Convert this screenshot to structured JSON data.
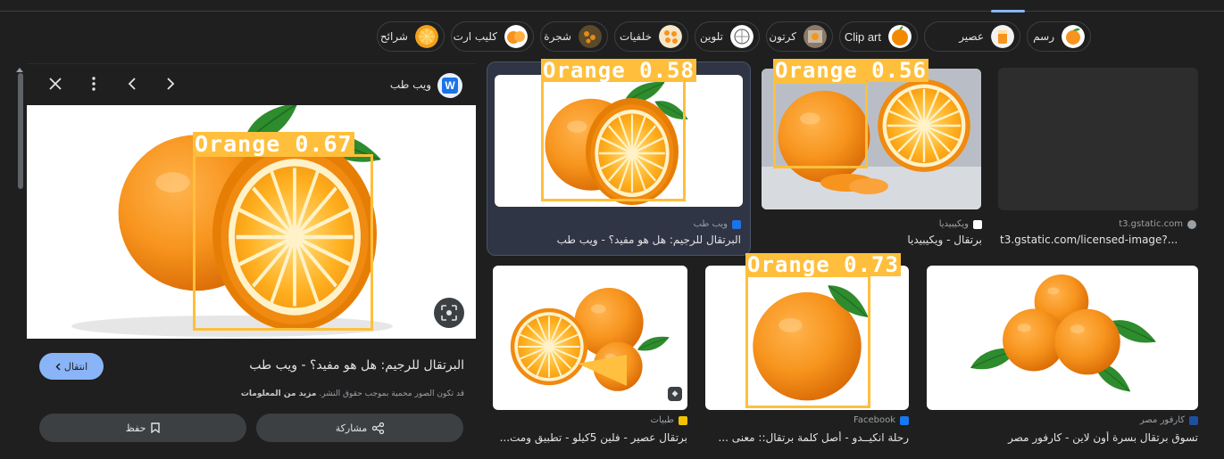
{
  "chips": [
    {
      "label": "رسم",
      "ltr": false
    },
    {
      "label": "عصير",
      "ltr": false
    },
    {
      "label": "Clip art",
      "ltr": true
    },
    {
      "label": "كرتون",
      "ltr": false
    },
    {
      "label": "تلوين",
      "ltr": false
    },
    {
      "label": "خلفيات",
      "ltr": false
    },
    {
      "label": "شجرة",
      "ltr": false
    },
    {
      "label": "كليب ارت",
      "ltr": false
    },
    {
      "label": "شرائح",
      "ltr": false
    }
  ],
  "panel": {
    "site_name": "ويب طب",
    "site_logo_letter": "W",
    "title": "البرتقال للرجيم: هل هو مفيد؟ - ويب طب",
    "visit_label": "انتقال",
    "notice": "قد تكون الصور محمية بموجب حقوق النشر.",
    "notice_more": "مزيد من المعلومات",
    "share_label": "مشاركة",
    "save_label": "حفظ",
    "detection": "Orange 0.67"
  },
  "cards": [
    {
      "source": "ويب طب",
      "caption": "البرتقال للرجيم: هل هو مفيد؟ - ويب طب",
      "detection": "Orange 0.58"
    },
    {
      "source": "ويكيبيديا",
      "caption": "برتقال - ويكيبيديا",
      "detection": "Orange 0.56"
    },
    {
      "source": "t3.gstatic.com",
      "caption": "t3.gstatic.com/licensed-image?..."
    },
    {
      "source": "طبيات",
      "caption": "برتقال عصير - فلين 5كيلو - تطبيق ومت..."
    },
    {
      "source": "Facebook",
      "caption": "رحلة انكيــدو - أصل كلمة برتقال:: معنى ...",
      "detection": "Orange 0.73"
    },
    {
      "source": "كارفور مصر",
      "caption": "تسوق برتقال بسرة أون لاين - كارفور مصر"
    }
  ],
  "colors": {
    "accent": "#8ab4f8",
    "detection": "#ffbf3c",
    "orange": "#f7941d"
  },
  "icons": {
    "close": "close-icon",
    "more": "more-vert-icon",
    "prev": "chevron-left-icon",
    "next": "chevron-right-icon",
    "lens": "lens-icon",
    "share": "share-icon",
    "bookmark": "bookmark-icon"
  }
}
